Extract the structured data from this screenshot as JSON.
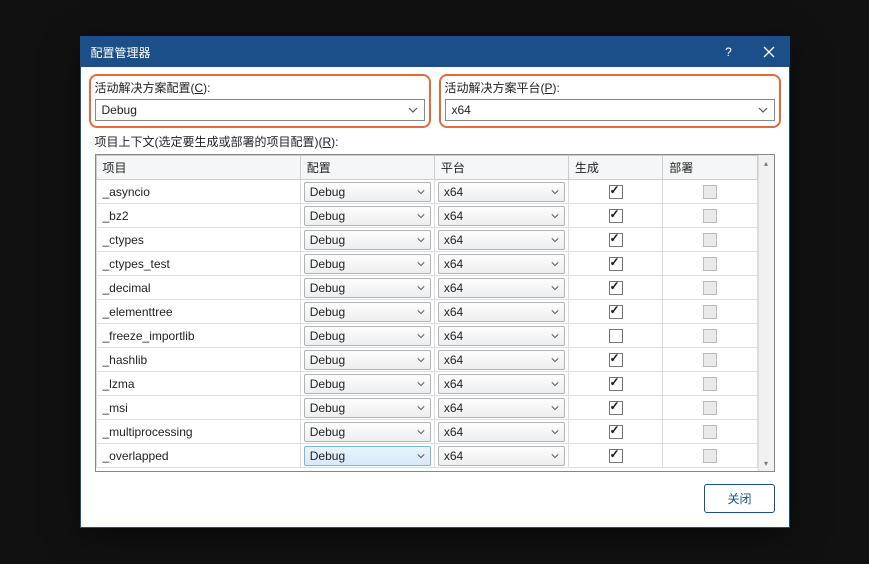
{
  "window": {
    "title": "配置管理器",
    "help_label": "?",
    "close_btn_text": "关闭"
  },
  "config_field": {
    "label_prefix": "活动解决方案配置(",
    "label_key": "C",
    "label_suffix": "):",
    "value": "Debug"
  },
  "platform_field": {
    "label_prefix": "活动解决方案平台(",
    "label_key": "P",
    "label_suffix": "):",
    "value": "x64"
  },
  "context_label": {
    "prefix": "项目上下文(选定要生成或部署的项目配置)(",
    "key": "R",
    "suffix": "):"
  },
  "columns": {
    "project": "项目",
    "config": "配置",
    "platform": "平台",
    "build": "生成",
    "deploy": "部署"
  },
  "rows": [
    {
      "project": "_asyncio",
      "config": "Debug",
      "platform": "x64",
      "build": true,
      "deploy_enabled": false
    },
    {
      "project": "_bz2",
      "config": "Debug",
      "platform": "x64",
      "build": true,
      "deploy_enabled": false
    },
    {
      "project": "_ctypes",
      "config": "Debug",
      "platform": "x64",
      "build": true,
      "deploy_enabled": false
    },
    {
      "project": "_ctypes_test",
      "config": "Debug",
      "platform": "x64",
      "build": true,
      "deploy_enabled": false
    },
    {
      "project": "_decimal",
      "config": "Debug",
      "platform": "x64",
      "build": true,
      "deploy_enabled": false
    },
    {
      "project": "_elementtree",
      "config": "Debug",
      "platform": "x64",
      "build": true,
      "deploy_enabled": false
    },
    {
      "project": "_freeze_importlib",
      "config": "Debug",
      "platform": "x64",
      "build": false,
      "deploy_enabled": false
    },
    {
      "project": "_hashlib",
      "config": "Debug",
      "platform": "x64",
      "build": true,
      "deploy_enabled": false
    },
    {
      "project": "_lzma",
      "config": "Debug",
      "platform": "x64",
      "build": true,
      "deploy_enabled": false
    },
    {
      "project": "_msi",
      "config": "Debug",
      "platform": "x64",
      "build": true,
      "deploy_enabled": false
    },
    {
      "project": "_multiprocessing",
      "config": "Debug",
      "platform": "x64",
      "build": true,
      "deploy_enabled": false
    },
    {
      "project": "_overlapped",
      "config": "Debug",
      "platform": "x64",
      "build": true,
      "deploy_enabled": false,
      "selected": true
    }
  ]
}
